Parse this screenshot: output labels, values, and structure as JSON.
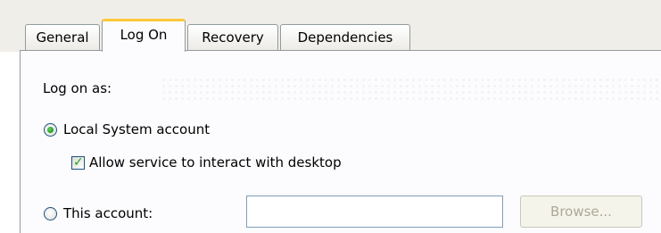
{
  "tabs": [
    {
      "label": "General"
    },
    {
      "label": "Log On"
    },
    {
      "label": "Recovery"
    },
    {
      "label": "Dependencies"
    }
  ],
  "selected_tab": "Log On",
  "logon": {
    "heading": "Log on as:",
    "local_system_label": "Local System account",
    "local_system_checked": true,
    "interact_label": "Allow service to interact with desktop",
    "interact_checked": true,
    "this_account_label": "This account:",
    "this_account_checked": false,
    "account_value": "",
    "browse_label": "Browse...",
    "browse_enabled": false
  },
  "colors": {
    "selected_tab_accent": "#ffc83c",
    "panel_border": "#919b9c",
    "input_border": "#7f9db9",
    "check_green": "#21a121",
    "disabled_text": "#aca899"
  },
  "icons": {
    "radio_selected": "radio-selected-icon",
    "checkbox_checked": "checkmark-icon"
  }
}
